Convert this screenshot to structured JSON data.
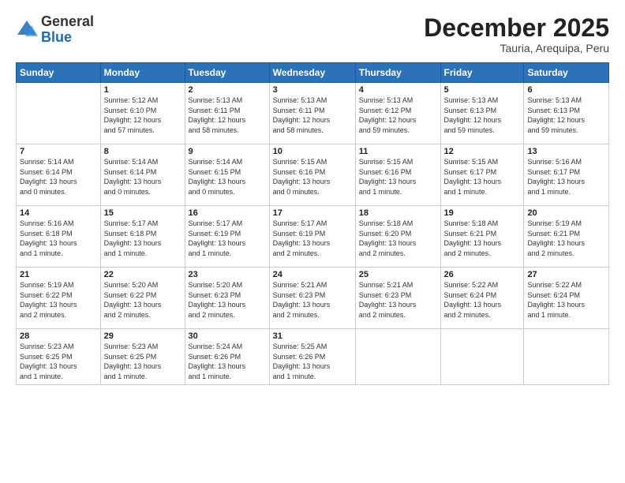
{
  "logo": {
    "general": "General",
    "blue": "Blue"
  },
  "header": {
    "title": "December 2025",
    "subtitle": "Tauria, Arequipa, Peru"
  },
  "days_of_week": [
    "Sunday",
    "Monday",
    "Tuesday",
    "Wednesday",
    "Thursday",
    "Friday",
    "Saturday"
  ],
  "weeks": [
    [
      {
        "day": "",
        "info": ""
      },
      {
        "day": "1",
        "info": "Sunrise: 5:12 AM\nSunset: 6:10 PM\nDaylight: 12 hours\nand 57 minutes."
      },
      {
        "day": "2",
        "info": "Sunrise: 5:13 AM\nSunset: 6:11 PM\nDaylight: 12 hours\nand 58 minutes."
      },
      {
        "day": "3",
        "info": "Sunrise: 5:13 AM\nSunset: 6:11 PM\nDaylight: 12 hours\nand 58 minutes."
      },
      {
        "day": "4",
        "info": "Sunrise: 5:13 AM\nSunset: 6:12 PM\nDaylight: 12 hours\nand 59 minutes."
      },
      {
        "day": "5",
        "info": "Sunrise: 5:13 AM\nSunset: 6:13 PM\nDaylight: 12 hours\nand 59 minutes."
      },
      {
        "day": "6",
        "info": "Sunrise: 5:13 AM\nSunset: 6:13 PM\nDaylight: 12 hours\nand 59 minutes."
      }
    ],
    [
      {
        "day": "7",
        "info": "Sunrise: 5:14 AM\nSunset: 6:14 PM\nDaylight: 13 hours\nand 0 minutes."
      },
      {
        "day": "8",
        "info": "Sunrise: 5:14 AM\nSunset: 6:14 PM\nDaylight: 13 hours\nand 0 minutes."
      },
      {
        "day": "9",
        "info": "Sunrise: 5:14 AM\nSunset: 6:15 PM\nDaylight: 13 hours\nand 0 minutes."
      },
      {
        "day": "10",
        "info": "Sunrise: 5:15 AM\nSunset: 6:16 PM\nDaylight: 13 hours\nand 0 minutes."
      },
      {
        "day": "11",
        "info": "Sunrise: 5:15 AM\nSunset: 6:16 PM\nDaylight: 13 hours\nand 1 minute."
      },
      {
        "day": "12",
        "info": "Sunrise: 5:15 AM\nSunset: 6:17 PM\nDaylight: 13 hours\nand 1 minute."
      },
      {
        "day": "13",
        "info": "Sunrise: 5:16 AM\nSunset: 6:17 PM\nDaylight: 13 hours\nand 1 minute."
      }
    ],
    [
      {
        "day": "14",
        "info": "Sunrise: 5:16 AM\nSunset: 6:18 PM\nDaylight: 13 hours\nand 1 minute."
      },
      {
        "day": "15",
        "info": "Sunrise: 5:17 AM\nSunset: 6:18 PM\nDaylight: 13 hours\nand 1 minute."
      },
      {
        "day": "16",
        "info": "Sunrise: 5:17 AM\nSunset: 6:19 PM\nDaylight: 13 hours\nand 1 minute."
      },
      {
        "day": "17",
        "info": "Sunrise: 5:17 AM\nSunset: 6:19 PM\nDaylight: 13 hours\nand 2 minutes."
      },
      {
        "day": "18",
        "info": "Sunrise: 5:18 AM\nSunset: 6:20 PM\nDaylight: 13 hours\nand 2 minutes."
      },
      {
        "day": "19",
        "info": "Sunrise: 5:18 AM\nSunset: 6:21 PM\nDaylight: 13 hours\nand 2 minutes."
      },
      {
        "day": "20",
        "info": "Sunrise: 5:19 AM\nSunset: 6:21 PM\nDaylight: 13 hours\nand 2 minutes."
      }
    ],
    [
      {
        "day": "21",
        "info": "Sunrise: 5:19 AM\nSunset: 6:22 PM\nDaylight: 13 hours\nand 2 minutes."
      },
      {
        "day": "22",
        "info": "Sunrise: 5:20 AM\nSunset: 6:22 PM\nDaylight: 13 hours\nand 2 minutes."
      },
      {
        "day": "23",
        "info": "Sunrise: 5:20 AM\nSunset: 6:23 PM\nDaylight: 13 hours\nand 2 minutes."
      },
      {
        "day": "24",
        "info": "Sunrise: 5:21 AM\nSunset: 6:23 PM\nDaylight: 13 hours\nand 2 minutes."
      },
      {
        "day": "25",
        "info": "Sunrise: 5:21 AM\nSunset: 6:23 PM\nDaylight: 13 hours\nand 2 minutes."
      },
      {
        "day": "26",
        "info": "Sunrise: 5:22 AM\nSunset: 6:24 PM\nDaylight: 13 hours\nand 2 minutes."
      },
      {
        "day": "27",
        "info": "Sunrise: 5:22 AM\nSunset: 6:24 PM\nDaylight: 13 hours\nand 1 minute."
      }
    ],
    [
      {
        "day": "28",
        "info": "Sunrise: 5:23 AM\nSunset: 6:25 PM\nDaylight: 13 hours\nand 1 minute."
      },
      {
        "day": "29",
        "info": "Sunrise: 5:23 AM\nSunset: 6:25 PM\nDaylight: 13 hours\nand 1 minute."
      },
      {
        "day": "30",
        "info": "Sunrise: 5:24 AM\nSunset: 6:26 PM\nDaylight: 13 hours\nand 1 minute."
      },
      {
        "day": "31",
        "info": "Sunrise: 5:25 AM\nSunset: 6:26 PM\nDaylight: 13 hours\nand 1 minute."
      },
      {
        "day": "",
        "info": ""
      },
      {
        "day": "",
        "info": ""
      },
      {
        "day": "",
        "info": ""
      }
    ]
  ]
}
